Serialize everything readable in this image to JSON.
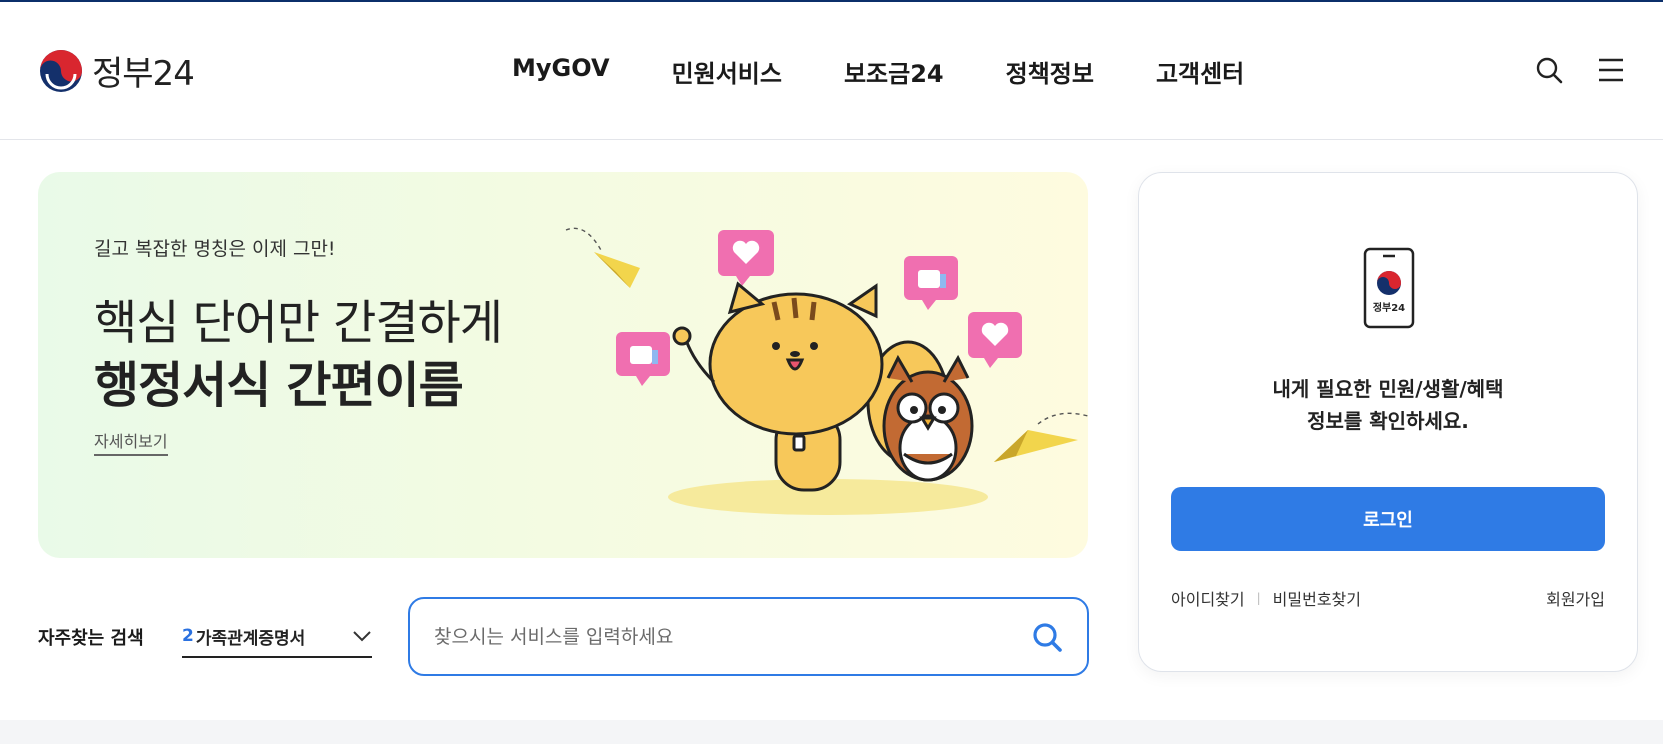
{
  "header": {
    "logo_text": "정부24",
    "nav": [
      "MyGOV",
      "민원서비스",
      "보조금24",
      "정책정보",
      "고객센터"
    ],
    "icons": [
      "search-icon",
      "menu-icon"
    ]
  },
  "banner": {
    "subtitle": "길고 복잡한 명칭은 이제 그만!",
    "title_line1": "핵심 단어만 간결하게",
    "title_line2": "행정서식 간편이름",
    "more_link": "자세히보기"
  },
  "search": {
    "frequent_label": "자주찾는 검색",
    "frequent_rank": "2",
    "frequent_term": "가족관계증명서",
    "placeholder": "찾으시는 서비스를 입력하세요"
  },
  "login_card": {
    "phone_label": "정부24",
    "message_line1": "내게 필요한 민원/생활/혜택",
    "message_line2": "정보를 확인하세요.",
    "login_button": "로그인",
    "find_id": "아이디찾기",
    "find_password": "비밀번호찾기",
    "signup": "회원가입"
  },
  "colors": {
    "accent": "#2f7be5",
    "topline": "#0b2f6a",
    "heart_bubble": "#f06fb0",
    "character": "#f7c85a"
  }
}
